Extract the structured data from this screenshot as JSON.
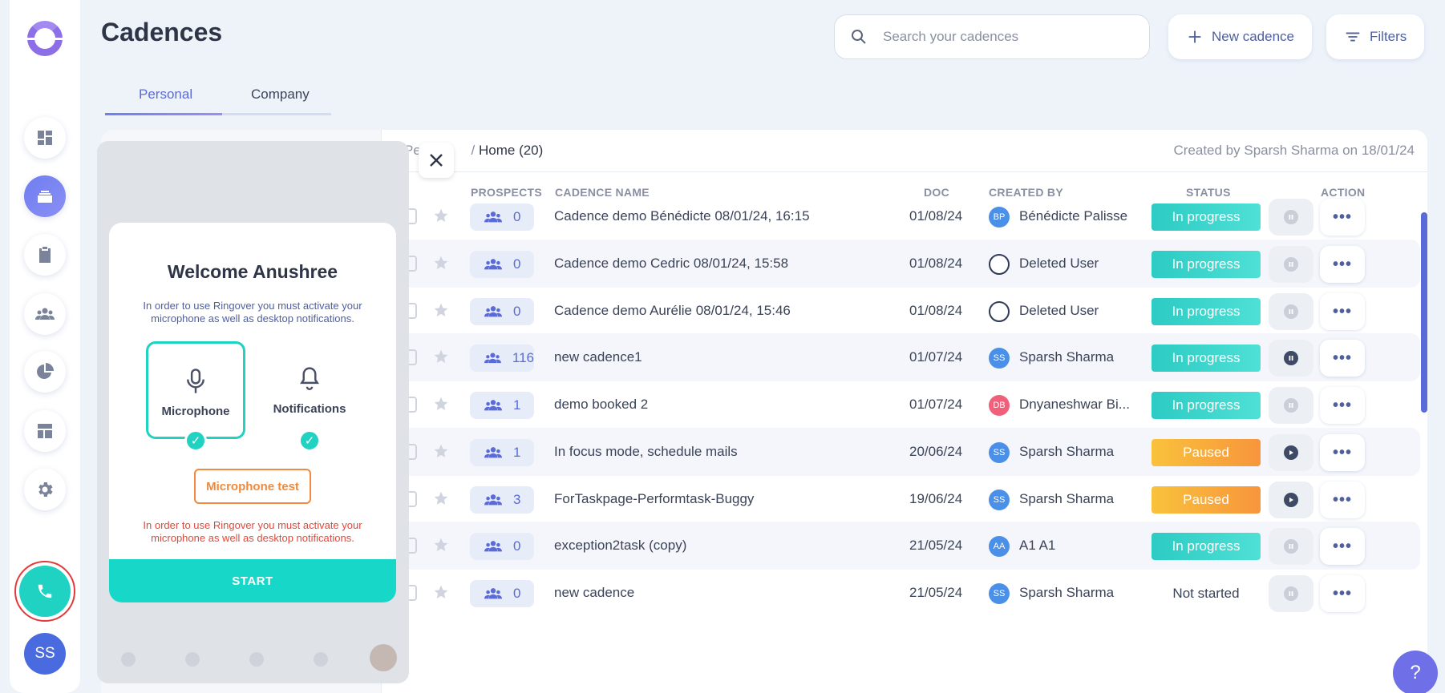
{
  "page": {
    "title": "Cadences"
  },
  "search": {
    "placeholder": "Search your cadences"
  },
  "header": {
    "new_cadence": "New cadence",
    "filters": "Filters"
  },
  "tabs": [
    {
      "label": "Personal"
    },
    {
      "label": "Company"
    }
  ],
  "breadcrumb": {
    "prefix": "Pe",
    "separator": "/",
    "current": "Home (20)"
  },
  "created_info": "Created by Sparsh Sharma on 18/01/24",
  "columns": {
    "prospects": "PROSPECTS",
    "cadence_name": "CADENCE NAME",
    "doc": "DOC",
    "created_by": "CREATED BY",
    "status": "STATUS",
    "action": "ACTION"
  },
  "rows": [
    {
      "prospects": "0",
      "name": "Cadence demo Bénédicte 08/01/24, 16:15",
      "doc": "01/08/24",
      "creator": "Bénédicte Palisse",
      "initials": "BP",
      "avatar_color": "#4a8fe8",
      "status": "In progress",
      "status_type": "progress",
      "action": "pause-disabled"
    },
    {
      "prospects": "0",
      "name": "Cadence demo Cedric 08/01/24, 15:58",
      "doc": "01/08/24",
      "creator": "Deleted User",
      "initials": "",
      "avatar_color": "#2e3a56",
      "status": "In progress",
      "status_type": "progress",
      "action": "pause-disabled"
    },
    {
      "prospects": "0",
      "name": "Cadence demo Aurélie 08/01/24, 15:46",
      "doc": "01/08/24",
      "creator": "Deleted User",
      "initials": "",
      "avatar_color": "#2e3a56",
      "status": "In progress",
      "status_type": "progress",
      "action": "pause-disabled"
    },
    {
      "prospects": "116",
      "name": "new cadence1",
      "doc": "01/07/24",
      "creator": "Sparsh Sharma",
      "initials": "SS",
      "avatar_color": "#4a8fe8",
      "status": "In progress",
      "status_type": "progress",
      "action": "pause"
    },
    {
      "prospects": "1",
      "name": "demo booked 2",
      "doc": "01/07/24",
      "creator": "Dnyaneshwar Bi...",
      "initials": "DB",
      "avatar_color": "#f0607a",
      "status": "In progress",
      "status_type": "progress",
      "action": "pause-disabled"
    },
    {
      "prospects": "1",
      "name": "In focus mode, schedule mails",
      "doc": "20/06/24",
      "creator": "Sparsh Sharma",
      "initials": "SS",
      "avatar_color": "#4a8fe8",
      "status": "Paused",
      "status_type": "paused",
      "action": "play"
    },
    {
      "prospects": "3",
      "name": "ForTaskpage-Performtask-Buggy",
      "doc": "19/06/24",
      "creator": "Sparsh Sharma",
      "initials": "SS",
      "avatar_color": "#4a8fe8",
      "status": "Paused",
      "status_type": "paused",
      "action": "play"
    },
    {
      "prospects": "0",
      "name": "exception2task (copy)",
      "doc": "21/05/24",
      "creator": "A1 A1",
      "initials": "AA",
      "avatar_color": "#4a8fe8",
      "status": "In progress",
      "status_type": "progress",
      "action": "pause-disabled"
    },
    {
      "prospects": "0",
      "name": "new cadence",
      "doc": "21/05/24",
      "creator": "Sparsh Sharma",
      "initials": "SS",
      "avatar_color": "#4a8fe8",
      "status": "Not started",
      "status_type": "none",
      "action": "pause-disabled"
    }
  ],
  "widget": {
    "title": "Welcome Anushree",
    "intro": "In order to use Ringover you must activate your microphone as well as desktop notifications.",
    "microphone": "Microphone",
    "notifications": "Notifications",
    "mic_test": "Microphone test",
    "warning": "In order to use Ringover you must activate your microphone as well as desktop notifications.",
    "start": "START"
  },
  "user": {
    "initials": "SS"
  },
  "colors": {
    "accent": "#5a6bd8",
    "teal": "#1fd2c2",
    "progress": "#2fd0c8",
    "paused": "#f7a23c",
    "warning": "#e0483a",
    "orange": "#f08a3c"
  },
  "icons": {
    "dashboard": "dashboard-icon",
    "cadences": "cadences-icon",
    "tasks": "clipboard-icon",
    "prospects": "people-icon",
    "reports": "pie-chart-icon",
    "templates": "template-icon",
    "settings": "gear-icon",
    "phone": "phone-icon",
    "help": "help-icon"
  }
}
